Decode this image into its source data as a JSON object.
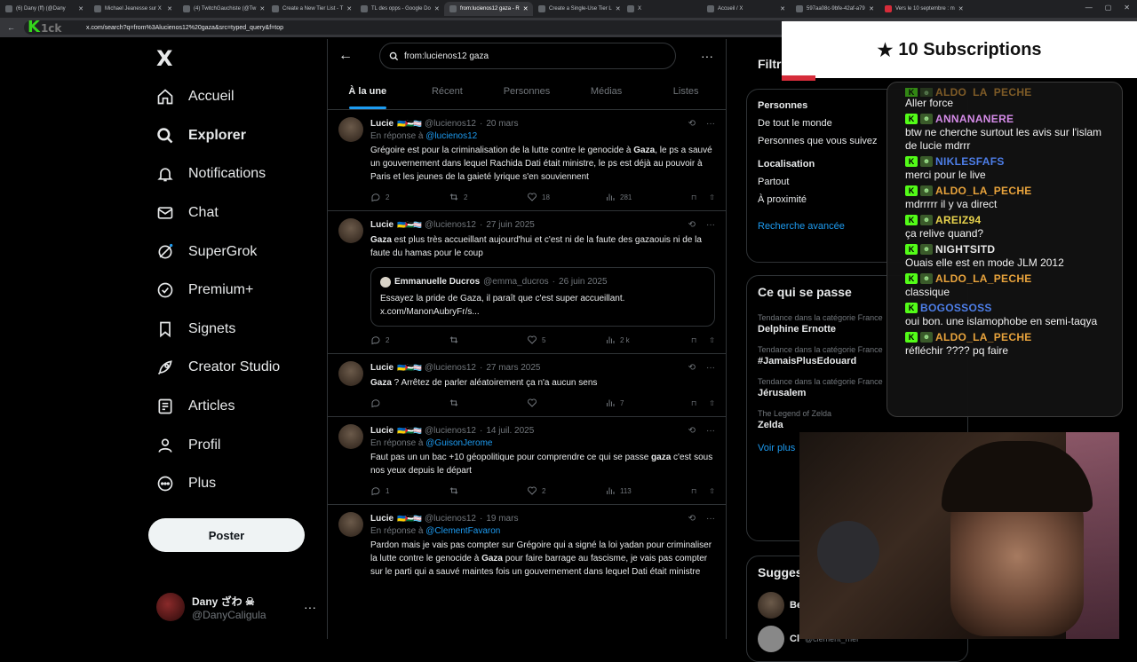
{
  "browser": {
    "tabs": [
      {
        "label": "(6) Dany (ff) (@Dany",
        "active": false
      },
      {
        "label": "Michael Jeanesse sur X",
        "active": false
      },
      {
        "label": "(4) TwitchGauchiste (@Tw",
        "active": false
      },
      {
        "label": "Create a New Tier List - T",
        "active": false
      },
      {
        "label": "TL des opps - Google Do",
        "active": false
      },
      {
        "label": "from:lucienos12 gaza - R",
        "active": true
      },
      {
        "label": "Create a Single-Use Tier L",
        "active": false
      },
      {
        "label": "X",
        "active": false
      },
      {
        "label": "Accueil / X",
        "active": false
      },
      {
        "label": "597aa08c-9bfe-42af-a79",
        "active": false
      },
      {
        "label": "Vers le 10 septembre : m",
        "active": false
      }
    ],
    "url": "x.com/search?q=from%3Alucienos12%20gaza&src=typed_query&f=top",
    "stream_logo": "K",
    "stream_logo_suffix": "1ck"
  },
  "sidebar": {
    "logo": "X",
    "items": [
      {
        "label": "Accueil",
        "icon": "home-icon"
      },
      {
        "label": "Explorer",
        "icon": "search-icon"
      },
      {
        "label": "Notifications",
        "icon": "bell-icon"
      },
      {
        "label": "Chat",
        "icon": "mail-icon"
      },
      {
        "label": "SuperGrok",
        "icon": "grok-icon"
      },
      {
        "label": "Premium+",
        "icon": "verified-icon"
      },
      {
        "label": "Signets",
        "icon": "bookmark-icon"
      },
      {
        "label": "Creator Studio",
        "icon": "rocket-icon"
      },
      {
        "label": "Articles",
        "icon": "article-icon"
      },
      {
        "label": "Profil",
        "icon": "person-icon"
      },
      {
        "label": "Plus",
        "icon": "more-circle-icon"
      }
    ],
    "post_label": "Poster",
    "profile": {
      "name": "Dany ざわ ☠",
      "handle": "@DanyCaligula"
    }
  },
  "search": {
    "query": "from:lucienos12 gaza",
    "tabs": [
      "À la une",
      "Récent",
      "Personnes",
      "Médias",
      "Listes"
    ]
  },
  "tweets": [
    {
      "name": "Lucie",
      "handle": "@lucienos12",
      "date": "20 mars",
      "reply_prefix": "En réponse à",
      "reply_to": "@lucienos12",
      "text_before": "Grégoire est pour la criminalisation de la lutte contre le genocide à ",
      "highlight": "Gaza",
      "text_after": ", le ps a sauvé un gouvernement dans lequel Rachida Dati était ministre, le ps est déjà au pouvoir à Paris et les jeunes de la gaieté lyrique s'en souviennent",
      "replies": "2",
      "retweets": "2",
      "likes": "18",
      "views": "281"
    },
    {
      "name": "Lucie",
      "handle": "@lucienos12",
      "date": "27 juin 2025",
      "text_before": "",
      "highlight": "Gaza",
      "text_after": " est plus très accueillant aujourd'hui et c'est ni de la faute des gazaouis ni de la faute du hamas pour le coup",
      "quote": {
        "name": "Emmanuelle Ducros",
        "handle": "@emma_ducros",
        "date": "26 juin 2025",
        "text": "Essayez la pride de Gaza, il paraît que c'est super accueillant. x.com/ManonAubryFr/s..."
      },
      "replies": "2",
      "retweets": "",
      "likes": "5",
      "views": "2 k"
    },
    {
      "name": "Lucie",
      "handle": "@lucienos12",
      "date": "27 mars 2025",
      "text_before": "",
      "highlight": "Gaza",
      "text_after": " ? Arrêtez de parler aléatoirement ça n'a aucun sens",
      "replies": "",
      "retweets": "",
      "likes": "",
      "views": "7"
    },
    {
      "name": "Lucie",
      "handle": "@lucienos12",
      "date": "14 juil. 2025",
      "reply_prefix": "En réponse à",
      "reply_to": "@GuisonJerome",
      "text_before": "Faut pas un un bac +10 géopolitique pour comprendre ce qui se passe ",
      "highlight": "gaza",
      "text_after": " c'est sous nos yeux depuis le départ",
      "replies": "1",
      "retweets": "",
      "likes": "2",
      "views": "113"
    },
    {
      "name": "Lucie",
      "handle": "@lucienos12",
      "date": "19 mars",
      "reply_prefix": "En réponse à",
      "reply_to": "@ClementFavaron",
      "text_before": "Pardon mais je vais pas compter sur Grégoire qui a signé la loi yadan pour criminaliser la lutte contre le genocide à ",
      "highlight": "Gaza",
      "text_after": " pour faire barrage au fascisme, je vais pas compter sur le parti qui a sauvé maintes fois un gouvernement dans lequel Dati était ministre",
      "replies": "",
      "retweets": "",
      "likes": "",
      "views": ""
    }
  ],
  "filters": {
    "title": "Filtres",
    "people_heading": "Personnes",
    "people_options": [
      "De tout le monde",
      "Personnes que vous suivez"
    ],
    "location_heading": "Localisation",
    "location_options": [
      "Partout",
      "À proximité"
    ],
    "advanced": "Recherche avancée"
  },
  "trends": {
    "title": "Ce qui se passe",
    "items": [
      {
        "category": "Tendance dans la catégorie France",
        "name": "Delphine Ernotte"
      },
      {
        "category": "Tendance dans la catégorie France",
        "name": "#JamaisPlusEdouard"
      },
      {
        "category": "Tendance dans la catégorie France",
        "name": "Jérusalem"
      },
      {
        "category": "The Legend of Zelda",
        "name": "Zelda"
      }
    ],
    "show_more": "Voir plus"
  },
  "suggestions": {
    "title": "Suggestions",
    "items": [
      "Be",
      "Cl"
    ],
    "handle_fragment": "@clement_mer"
  },
  "overlay": {
    "subscriptions": "10 Subscriptions",
    "chat": [
      {
        "user": "ALDO_LA_PECHE",
        "color": "#e8a33c",
        "text": "Aller force"
      },
      {
        "user": "ANNANANERE",
        "color": "#d58be8",
        "text": "btw ne cherche surtout les avis sur l'islam de lucie mdrrr"
      },
      {
        "user": "NIKLESFAFS",
        "color": "#4d7ee8",
        "text": "merci pour le live"
      },
      {
        "user": "ALDO_LA_PECHE",
        "color": "#e8a33c",
        "text": "mdrrrrr il y va direct"
      },
      {
        "user": "AREIZ94",
        "color": "#e8d34d",
        "text": "ça relive quand?"
      },
      {
        "user": "NIGHTSITD",
        "color": "#e8e8e8",
        "text": "Ouais elle est en mode JLM 2012"
      },
      {
        "user": "ALDO_LA_PECHE",
        "color": "#e8a33c",
        "text": "classique"
      },
      {
        "user": "BOGOSSOSS",
        "color": "#4d7ee8",
        "text": "oui bon. une islamophobe en semi-taqya"
      },
      {
        "user": "ALDO_LA_PECHE",
        "color": "#e8a33c",
        "text": "réfléchir ???? pq faire"
      }
    ]
  }
}
